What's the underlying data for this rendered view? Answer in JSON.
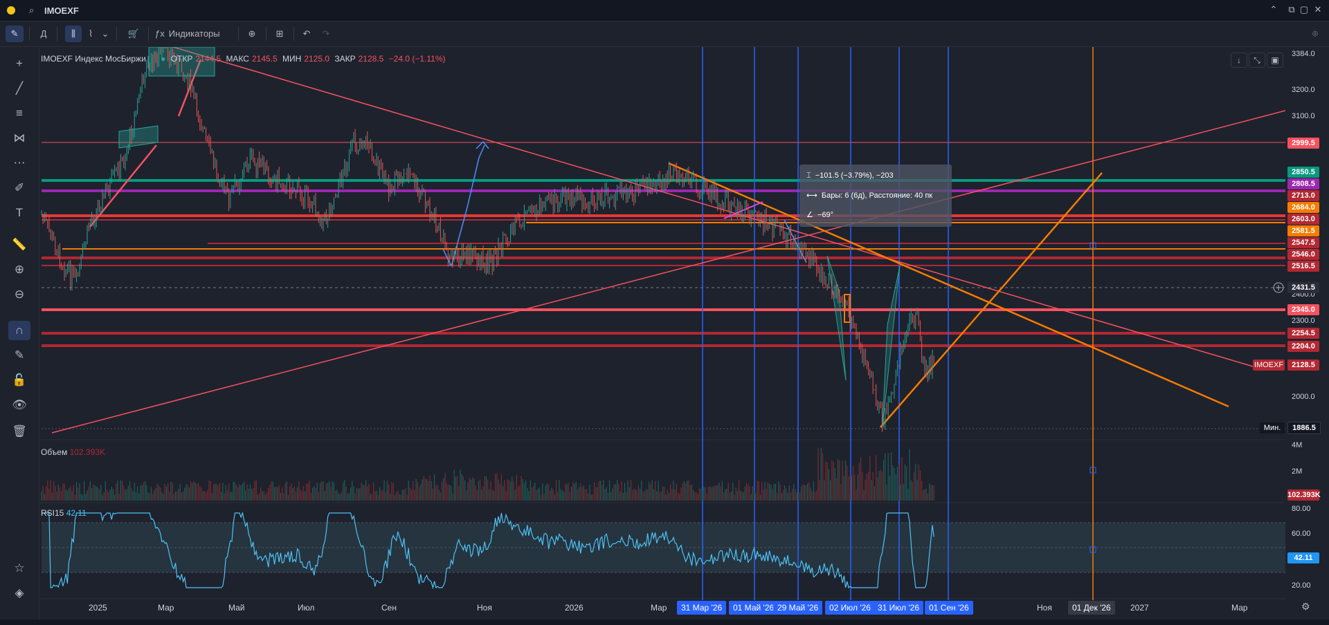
{
  "app": {
    "search_value": "IMOEXF"
  },
  "toolbar": {
    "interval": "Д",
    "indicators_label": "Индикаторы"
  },
  "legend": {
    "name": "IMOEXF Индекс МосБиржи",
    "open_label": "ОТКР",
    "open": "2144.5",
    "high_label": "МАКС",
    "high": "2145.5",
    "low_label": "МИН",
    "low": "2125.0",
    "close_label": "ЗАКР",
    "close": "2128.5",
    "change": "−24.0 (−1.11%)"
  },
  "volume": {
    "label": "Объем",
    "value": "102.393K"
  },
  "rsi": {
    "label": "RSI15",
    "value": "42.11"
  },
  "measure_tooltip": {
    "line1": "−101.5 (−3.79%), −203",
    "line2": "Бары: 6 (6д), Расстояние: 40 пк",
    "line3": "−69°"
  },
  "price_axis": {
    "ticks": [
      "3384.0",
      "3200.0",
      "3100.0",
      "2400.0",
      "2300.0",
      "2000.0"
    ],
    "badges": [
      {
        "label": "2999.5",
        "color": "#f7525f",
        "name": "level-2999"
      },
      {
        "label": "2850.5",
        "color": "#089981",
        "name": "level-2850"
      },
      {
        "label": "2808.5",
        "color": "#9c27b0",
        "name": "level-2808"
      },
      {
        "label": "2713.0",
        "color": "#b22833",
        "name": "level-2713"
      },
      {
        "label": "2684.0",
        "color": "#f57c00",
        "name": "level-2684"
      },
      {
        "label": "2603.0",
        "color": "#b22833",
        "name": "level-2603"
      },
      {
        "label": "2581.5",
        "color": "#f57c00",
        "name": "level-2581"
      },
      {
        "label": "2547.5",
        "color": "#b22833",
        "name": "level-2547"
      },
      {
        "label": "2546.0",
        "color": "#b22833",
        "name": "level-2546"
      },
      {
        "label": "2516.5",
        "color": "#b22833",
        "name": "level-2516"
      },
      {
        "label": "2431.5",
        "color": "#2a2e39",
        "name": "level-crosshair"
      },
      {
        "label": "2345.0",
        "color": "#f7525f",
        "name": "level-2345"
      },
      {
        "label": "2254.5",
        "color": "#b22833",
        "name": "level-2254"
      },
      {
        "label": "2204.0",
        "color": "#b22833",
        "name": "level-2204"
      },
      {
        "label": "2128.5",
        "color": "#b22833",
        "name": "level-last"
      },
      {
        "label": "1886.5",
        "color": "#131722",
        "name": "level-min"
      }
    ],
    "last_symbol": "IMOEXF",
    "min_label": "Мин."
  },
  "volume_axis": {
    "ticks": [
      "4M",
      "2M"
    ],
    "badge": "102.393K"
  },
  "rsi_axis": {
    "ticks": [
      "80.00",
      "60.00",
      "20.00"
    ],
    "badge": "42.11"
  },
  "time_axis": {
    "labels": [
      "2025",
      "Мар",
      "Май",
      "Июл",
      "Сен",
      "Ноя",
      "2026",
      "Мар",
      "Ноя",
      "2027",
      "Мар"
    ],
    "badges": [
      "31 Мар '26",
      "01 Май '26",
      "29 Май '26",
      "02 Июл '26",
      "31 Июл '26",
      "01 Сен '26",
      "01 Дек '26"
    ]
  },
  "colors": {
    "bg": "#1e222d",
    "up": "#26a69a",
    "down": "#ef5350",
    "accent": "#2962ff",
    "orange": "#f57c00",
    "red": "#f7525f"
  }
}
